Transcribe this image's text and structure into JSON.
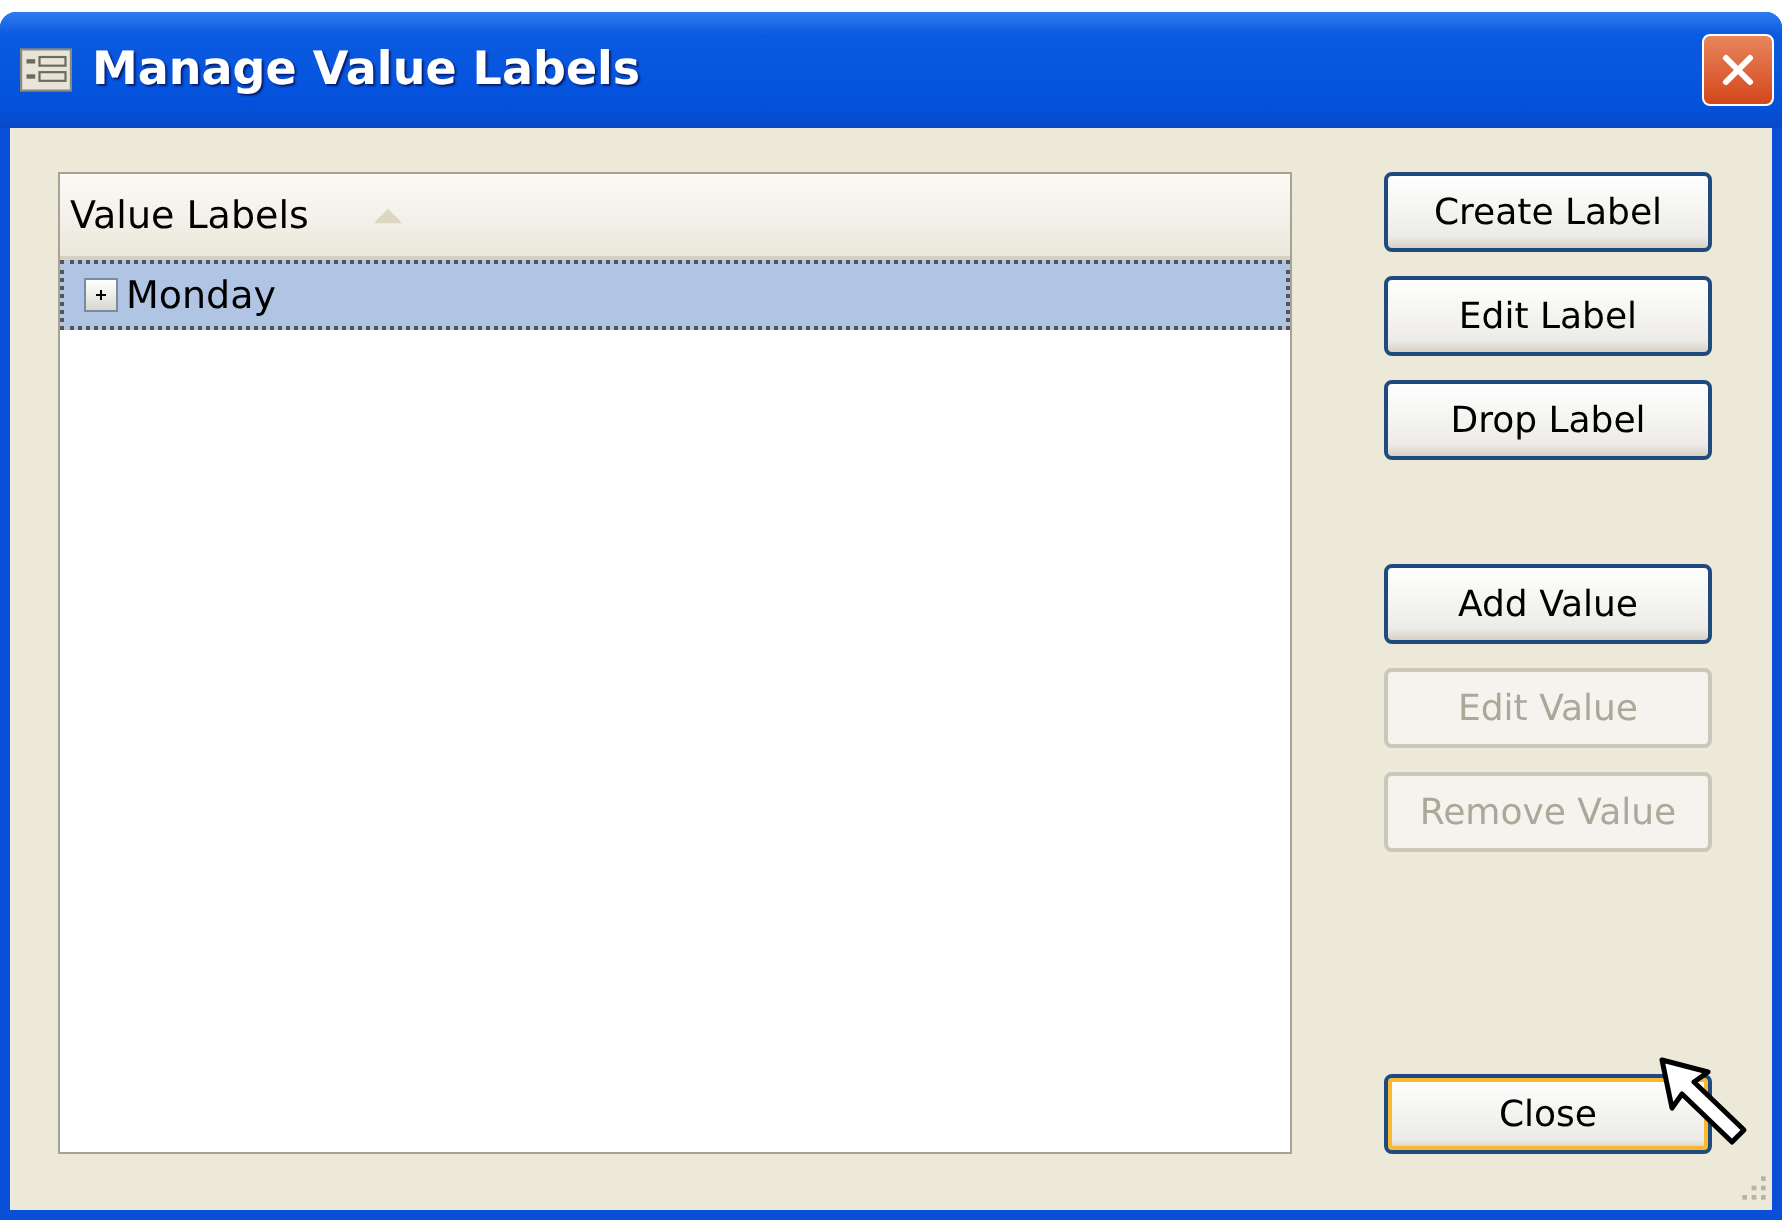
{
  "window": {
    "title": "Manage Value Labels"
  },
  "list": {
    "column": {
      "label": "Value Labels",
      "sorted_ascending": true
    },
    "items": [
      {
        "label": "Monday",
        "expanded": false,
        "selected": true
      }
    ]
  },
  "button_groups": [
    [
      {
        "label": "Create Label",
        "disabled": false,
        "focused": false
      },
      {
        "label": "Edit Label",
        "disabled": false,
        "focused": false
      },
      {
        "label": "Drop Label",
        "disabled": false,
        "focused": false
      }
    ],
    [
      {
        "label": "Add Value",
        "disabled": false,
        "focused": false
      },
      {
        "label": "Edit Value",
        "disabled": true,
        "focused": false
      },
      {
        "label": "Remove Value",
        "disabled": true,
        "focused": false
      }
    ],
    [
      {
        "label": "Close",
        "disabled": false,
        "focused": true
      }
    ]
  ]
}
